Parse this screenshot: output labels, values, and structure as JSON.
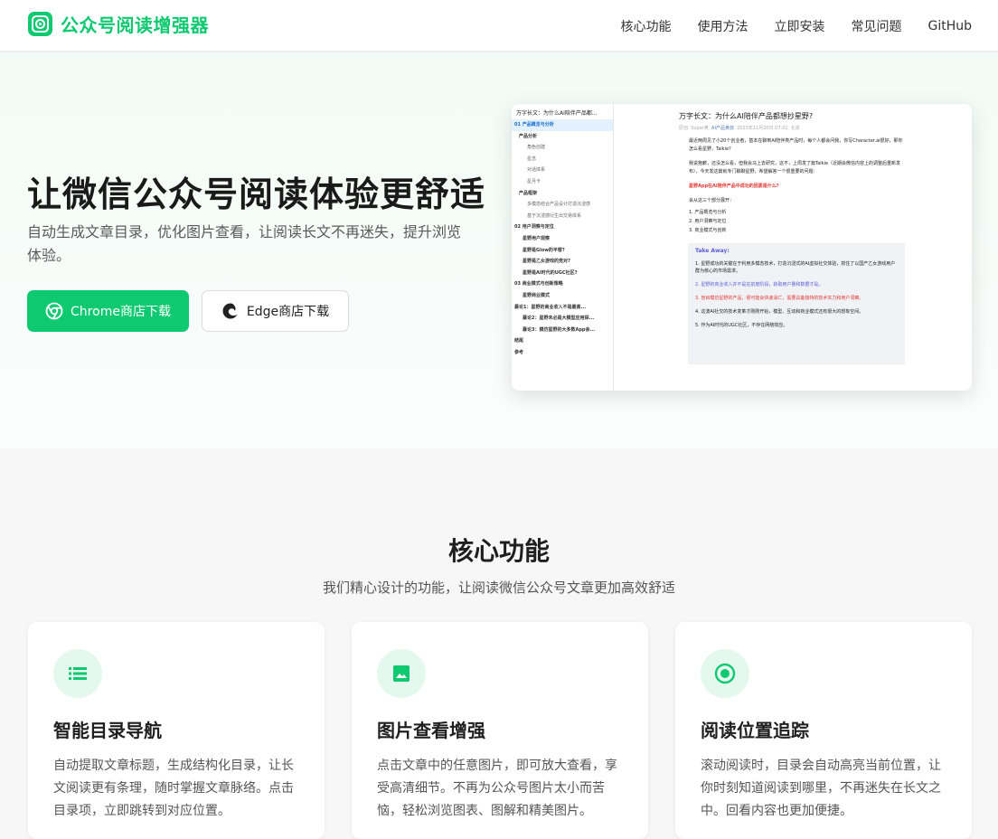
{
  "header": {
    "logo_text": "公众号阅读增强器",
    "nav": [
      "核心功能",
      "使用方法",
      "立即安装",
      "常见问题",
      "GitHub"
    ]
  },
  "hero": {
    "title": "让微信公众号阅读体验更舒适",
    "subtitle": "自动生成文章目录，优化图片查看，让阅读长文不再迷失，提升浏览体验。",
    "chrome_button": "Chrome商店下载",
    "edge_button": "Edge商店下载"
  },
  "preview": {
    "toc_title": "万字长文：为什么AI陪伴产品都...",
    "toc_items": [
      "01 产品概览与分析",
      "产品分析",
      "角色创建",
      "星念",
      "对话体系",
      "星月卡",
      "产品框架",
      "多模态结合产品设计打造沉浸感",
      "基于沉浸感衍生出交易体系",
      "02 用户洞察与定位",
      "星野用户观察",
      "星野是Glow的平替?",
      "星野是乙女游戏的竞对?",
      "星野是AI时代的UGC社区?",
      "03 商业模式与创新策略",
      "星野商业模式",
      "暴论1：星野的商业收入不是最高...",
      "暴论2：星野未必是大模型应用探...",
      "暴论3：模仿星野的大多数App会...",
      "结尾",
      "参考"
    ],
    "article_title": "万字长文：为什么AI陪伴产品都想抄星野?",
    "meta_tag": "原创",
    "meta_author": "Super黄",
    "meta_link": "AI产品黄叔",
    "meta_date": "2023年11月20日 07:02",
    "meta_place": "北京",
    "paragraphs": [
      "最近两周见了小20个创业者，基本在聊到AI陪伴类产品时，每个人都会问我，你写Character.ai很好，那你怎么看星野，Talkie?",
      "我说抱歉，还没怎么看，但我会马上去研究，这不，上周发了篇Talkie（近期会微信内容上的调整后重新发布），今天发这篇就专门聊聊星野，希望解答一个很重要的问题："
    ],
    "red_question": "星野App在AI陪伴产品中成功的因素是什么?",
    "intro": "会从这三个部分展开：",
    "sections": [
      "1. 产品概览与分析",
      "2. 用户洞察与定位",
      "3. 商业模式与创新"
    ],
    "takeaway_title": "Take Away:",
    "takeaways": [
      "1. 星野成功的关键在于利用多模态技术，打造沉浸式的AI虚拟社交体验，抓住了以国产乙女游戏用户群为核心的市场需求。",
      "2. 星野的商业收入并不是在前度阶段，获取用户量和数据才是。",
      "3. 盲目模仿星野的产品，很可能会快速消亡，需要具备独特的技术实力和用户洞察。",
      "4. 这波AI社交的技术变革才刚刚开始，模型、互动和商业模式还有很大的想象空间。",
      "5. 作为AI时代的UGC社区，不存在网络效应。"
    ]
  },
  "features": {
    "title": "核心功能",
    "subtitle": "我们精心设计的功能，让阅读微信公众号文章更加高效舒适",
    "cards": [
      {
        "icon": "list-icon",
        "title": "智能目录导航",
        "desc": "自动提取文章标题，生成结构化目录，让长文阅读更有条理，随时掌握文章脉络。点击目录项，立即跳转到对应位置。"
      },
      {
        "icon": "image-icon",
        "title": "图片查看增强",
        "desc": "点击文章中的任意图片，即可放大查看，享受高清细节。不再为公众号图片太小而苦恼，轻松浏览图表、图解和精美图片。"
      },
      {
        "icon": "target-icon",
        "title": "阅读位置追踪",
        "desc": "滚动阅读时，目录会自动高亮当前位置，让你时刻知道阅读到哪里，不再迷失在长文之中。回看内容也更加便捷。"
      }
    ]
  },
  "colors": {
    "brand": "#0fc971",
    "brand_light": "#e5f8ee",
    "text": "#1f1f1f"
  }
}
